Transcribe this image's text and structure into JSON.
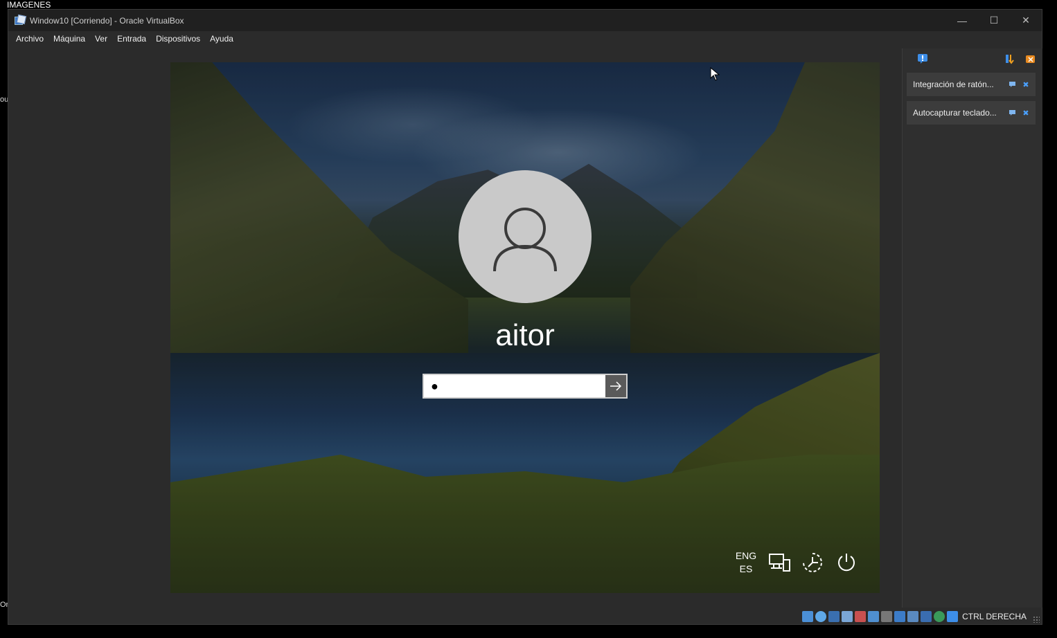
{
  "desktop": {
    "top_label": "IMAGENES",
    "left_edge_1": "ouc",
    "left_edge_2": "Ora"
  },
  "window": {
    "title": "Window10 [Corriendo] - Oracle VirtualBox",
    "controls": {
      "minimize": "—",
      "maximize": "☐",
      "close": "✕"
    }
  },
  "menubar": {
    "items": [
      {
        "label": "Archivo"
      },
      {
        "label": "Máquina"
      },
      {
        "label": "Ver"
      },
      {
        "label": "Entrada"
      },
      {
        "label": "Dispositivos"
      },
      {
        "label": "Ayuda"
      }
    ]
  },
  "login": {
    "username": "aitor",
    "password_value": "●",
    "language": {
      "line1": "ENG",
      "line2": "ES"
    },
    "icons": [
      "network-icon",
      "accessibility-icon",
      "power-icon"
    ]
  },
  "notifications": {
    "items": [
      {
        "label": "Integración de ratón..."
      },
      {
        "label": "Autocapturar teclado..."
      }
    ]
  },
  "statusbar": {
    "host_key": "CTRL DERECHA",
    "icons": [
      "hard-disk-icon",
      "optical-drive-icon",
      "floppy-icon",
      "audio-icon",
      "network-adapter-icon",
      "usb-icon",
      "shared-folder-icon",
      "display-icon",
      "recording-icon",
      "cpu-icon",
      "virtualization-icon",
      "mouse-integration-icon",
      "keyboard-capture-icon"
    ]
  },
  "colors": {
    "window_bg": "#2b2b2b",
    "titlebar_bg": "#202020",
    "pane_bg": "#2f2f2f",
    "notif_bg": "#3c3c3c"
  }
}
